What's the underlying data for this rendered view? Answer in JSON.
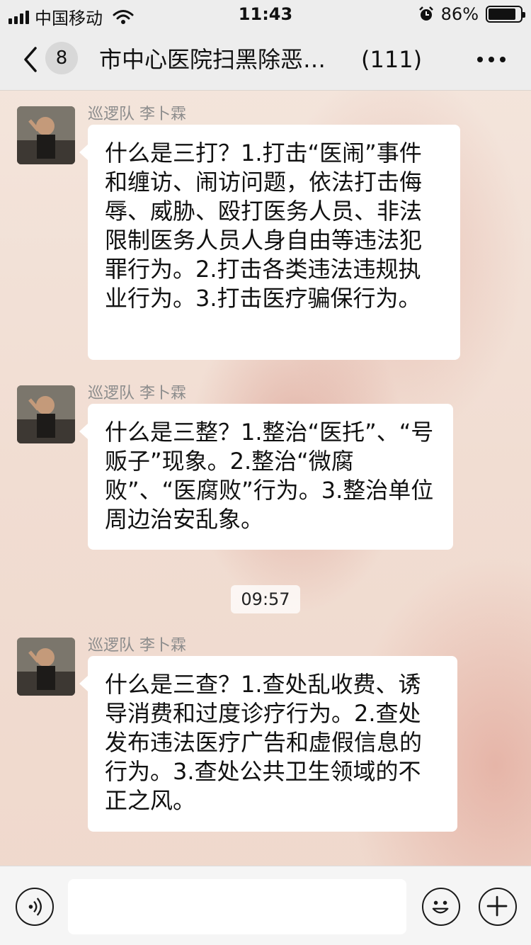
{
  "status_bar": {
    "carrier": "中国移动",
    "time": "11:43",
    "battery": "86%",
    "battery_level": 0.86,
    "icons": [
      "signal-icon",
      "wifi-icon",
      "alarm-icon",
      "battery-icon"
    ]
  },
  "nav": {
    "back_icon": "chevron-left-icon",
    "unread_count": "8",
    "title": "市中心医院扫黑除恶专…",
    "member_count": "(111)",
    "more_icon": "more-dots-icon"
  },
  "messages": [
    {
      "sender": "巡逻队 李卜霖",
      "text": "什么是三打？1.打击“医闹”事件和缠访、闹访问题，依法打击侮辱、威胁、殴打医务人员、非法限制医务人员人身自由等违法犯罪行为。2.打击各类违法违规执业行为。3.打击医疗骗保行为。"
    },
    {
      "sender": "巡逻队 李卜霖",
      "text": "什么是三整？1.整治“医托”、“号贩子”现象。2.整治“微腐败”、“医腐败”行为。3.整治单位周边治安乱象。"
    },
    {
      "sender": "巡逻队 李卜霖",
      "text": "什么是三查？1.查处乱收费、诱导消费和过度诊疗行为。2.查处发布违法医疗广告和虚假信息的行为。3.查处公共卫生领域的不正之风。"
    }
  ],
  "timestamp": "09:57",
  "input_bar": {
    "voice_icon": "voice-icon",
    "input_value": "",
    "emoji_icon": "emoji-icon",
    "plus_icon": "plus-icon"
  }
}
